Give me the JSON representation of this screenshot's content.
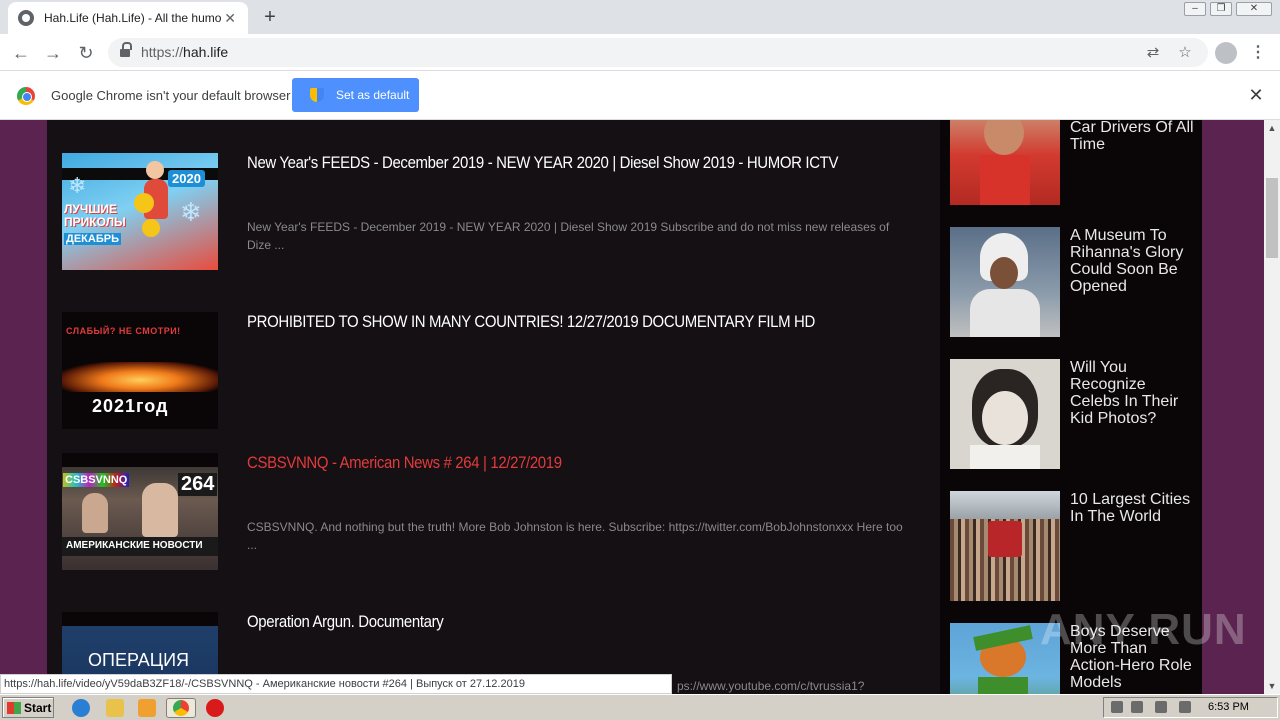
{
  "browser": {
    "tab_title": "Hah.Life (Hah.Life) - All the humor in",
    "new_tab": "+",
    "tab_close": "✕",
    "url_scheme": "https://",
    "url_host": "hah.life"
  },
  "infobar": {
    "message": "Google Chrome isn't your default browser",
    "button": "Set as default",
    "close": "✕"
  },
  "videos": [
    {
      "title": "New Year's FEEDS - December 2019 - NEW YEAR 2020 | Diesel Show 2019 - HUMOR ICTV",
      "description": "New Year's FEEDS - December 2019 - NEW YEAR 2020 | Diesel Show 2019 Subscribe and do not miss new releases of Dize ...",
      "thumb_text_1": "ЛУЧШИЕ ПРИКОЛЫ",
      "thumb_text_2": "ДЕКАБРЬ",
      "thumb_badge": "2020"
    },
    {
      "title": "PROHIBITED TO SHOW IN MANY COUNTRIES! 12/27/2019 DOCUMENTARY FILM HD",
      "description": "",
      "thumb_text_1": "СЛАБЫЙ? НЕ СМОТРИ!",
      "thumb_text_2": "2021год"
    },
    {
      "title": "CSBSVNNQ - American News # 264 | 12/27/2019",
      "description": "CSBSVNNQ. And nothing but the truth! More Bob Johnston is here. Subscribe: https://twitter.com/BobJohnstonxxx Here too ...",
      "thumb_text_1": "CSBSVNNQ",
      "thumb_badge": "264",
      "thumb_text_2": "АМЕРИКАНСКИЕ НОВОСТИ"
    },
    {
      "title": "Operation Argun. Documentary",
      "description": "ps://www.youtube.com/c/tvrussia1?",
      "thumb_text_1": "ОПЕРАЦИЯ"
    }
  ],
  "sidebar": [
    {
      "title": "Female Race Car Drivers Of All Time"
    },
    {
      "title": "A Museum To Rihanna's Glory Could Soon Be Opened"
    },
    {
      "title": "Will You Recognize Celebs In Their Kid Photos?"
    },
    {
      "title": "10 Largest Cities In The World"
    },
    {
      "title": "Boys Deserve More Than Action-Hero Role Models"
    }
  ],
  "status_url": "https://hah.life/video/yV59daB3ZF18/-/CSBSVNNQ - Американские новости #264 | Выпуск от 27.12.2019",
  "watermark": "ANY RUN",
  "taskbar": {
    "start": "Start",
    "clock": "6:53 PM"
  },
  "colors": {
    "page_bg": "#5a2350",
    "content_bg": "#141014",
    "accent_red": "#e23b3b",
    "button_blue": "#4d90fe"
  }
}
